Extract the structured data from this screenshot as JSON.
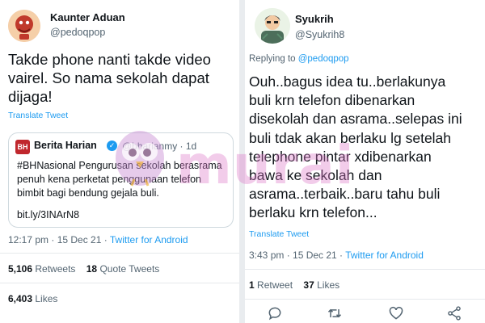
{
  "left_tweet": {
    "author": {
      "name": "Kaunter Aduan",
      "handle": "@pedoqpop"
    },
    "text_lines": [
      "Takde phone nanti takde video",
      "vairel. So nama sekolah dapat",
      "dijaga!"
    ],
    "translate_label": "Translate Tweet",
    "quote": {
      "logo_text": "BH",
      "name": "Berita Harian",
      "handle_time": "@bharianmy · 1d",
      "text_lines": [
        "#BHNasional Pengurusan sekolah berasrama",
        "penuh kena perketat penggunaan telefon",
        "bimbit bagi bendung gejala buli."
      ],
      "link": "bit.ly/3INArN8"
    },
    "meta": {
      "time": "12:17 pm · 15 Dec 21 · ",
      "source": "Twitter for Android"
    },
    "stats_row1": {
      "retweets_count": "5,106",
      "retweets_label": "Retweets",
      "quotes_count": "18",
      "quotes_label": "Quote Tweets"
    },
    "stats_row2": {
      "likes_count": "6,403",
      "likes_label": "Likes"
    }
  },
  "right_tweet": {
    "author": {
      "name": "Syukrih",
      "handle": "@Syukrih8"
    },
    "replying_to": {
      "prefix": "Replying to ",
      "mention": "@pedoqpop"
    },
    "text_lines": [
      "Ouh..bagus idea tu..berlakunya",
      "buli krn telefon dibenarkan",
      "disekolah dan asrama..selepas ini",
      "buli tdak akan berlaku lg setelah",
      "telephone pintar xdibenarkan",
      "bawa ke sekolah dan",
      "asrama..terbaik..baru tahu buli",
      "berlaku krn telefon..."
    ],
    "translate_label": "Translate Tweet",
    "meta": {
      "time": "3:43 pm · 15 Dec 21 · ",
      "source": "Twitter for Android"
    },
    "stats": {
      "retweets_count": "1",
      "retweets_label": "Retweet",
      "likes_count": "37",
      "likes_label": "Likes"
    },
    "actions": [
      "reply-icon",
      "retweet-icon",
      "like-icon",
      "share-icon"
    ]
  },
  "watermark": {
    "text": "murai"
  },
  "colors": {
    "link": "#1d9bf0",
    "muted": "#536471",
    "text": "#0f1419",
    "watermark": "#dc78c8"
  }
}
